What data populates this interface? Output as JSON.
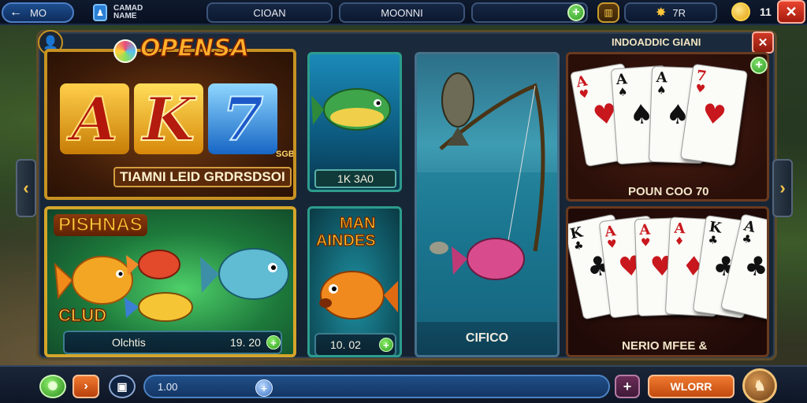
{
  "topbar": {
    "back_label": "MO",
    "profile_line1": "CAMAD",
    "profile_line2": "NAME",
    "tab1": "CIOAN",
    "tab2": "MOONNI",
    "level_label": "7R",
    "coins": "11"
  },
  "tiles": {
    "brand": "OPENSA",
    "ak_letters": [
      "A",
      "K",
      "7"
    ],
    "ak_sub": "TIAMNI LEID GRDRSDSOI",
    "ak_tag": "SGB",
    "fish_green_title": "PISHNAS",
    "fish_green_club": "CLUD",
    "fish_green_info_label": "Olchtis",
    "fish_green_info_value": "19. 20",
    "uw_label": "1K 3A0",
    "man_title_1": "MAN",
    "man_title_2": "AINDES",
    "man_info_value": "10. 02",
    "fishing_label": "CIFICO",
    "cards_top_title": "INDOADDIC GIANI",
    "cards_top_caption": "POUN COO 70",
    "cards_bot_caption": "NERIO MFEE &"
  },
  "cards_top": [
    {
      "rank": "A",
      "suit": "♥",
      "color": "red"
    },
    {
      "rank": "A",
      "suit": "♠",
      "color": "black"
    },
    {
      "rank": "A",
      "suit": "♠",
      "color": "black"
    },
    {
      "rank": "7",
      "suit": "♥",
      "color": "red"
    }
  ],
  "cards_bot": [
    {
      "rank": "K",
      "suit": "♣",
      "color": "black"
    },
    {
      "rank": "A",
      "suit": "♥",
      "color": "red"
    },
    {
      "rank": "A",
      "suit": "♥",
      "color": "red"
    },
    {
      "rank": "A",
      "suit": "♦",
      "color": "red"
    },
    {
      "rank": "K",
      "suit": "♣",
      "color": "black"
    },
    {
      "rank": "A",
      "suit": "♣",
      "color": "black"
    }
  ],
  "bottombar": {
    "amount": "1.00",
    "action_label": "WLORR"
  },
  "icons": {
    "back": "back-arrow-icon",
    "close": "close-icon",
    "coin": "coin-icon",
    "chevron_left": "chevron-left-icon",
    "chevron_right": "chevron-right-icon"
  },
  "colors": {
    "accent_gold": "#c79222",
    "close_red": "#e8452f",
    "plus_green": "#2f9a22",
    "bar_blue": "#1f4e88"
  }
}
